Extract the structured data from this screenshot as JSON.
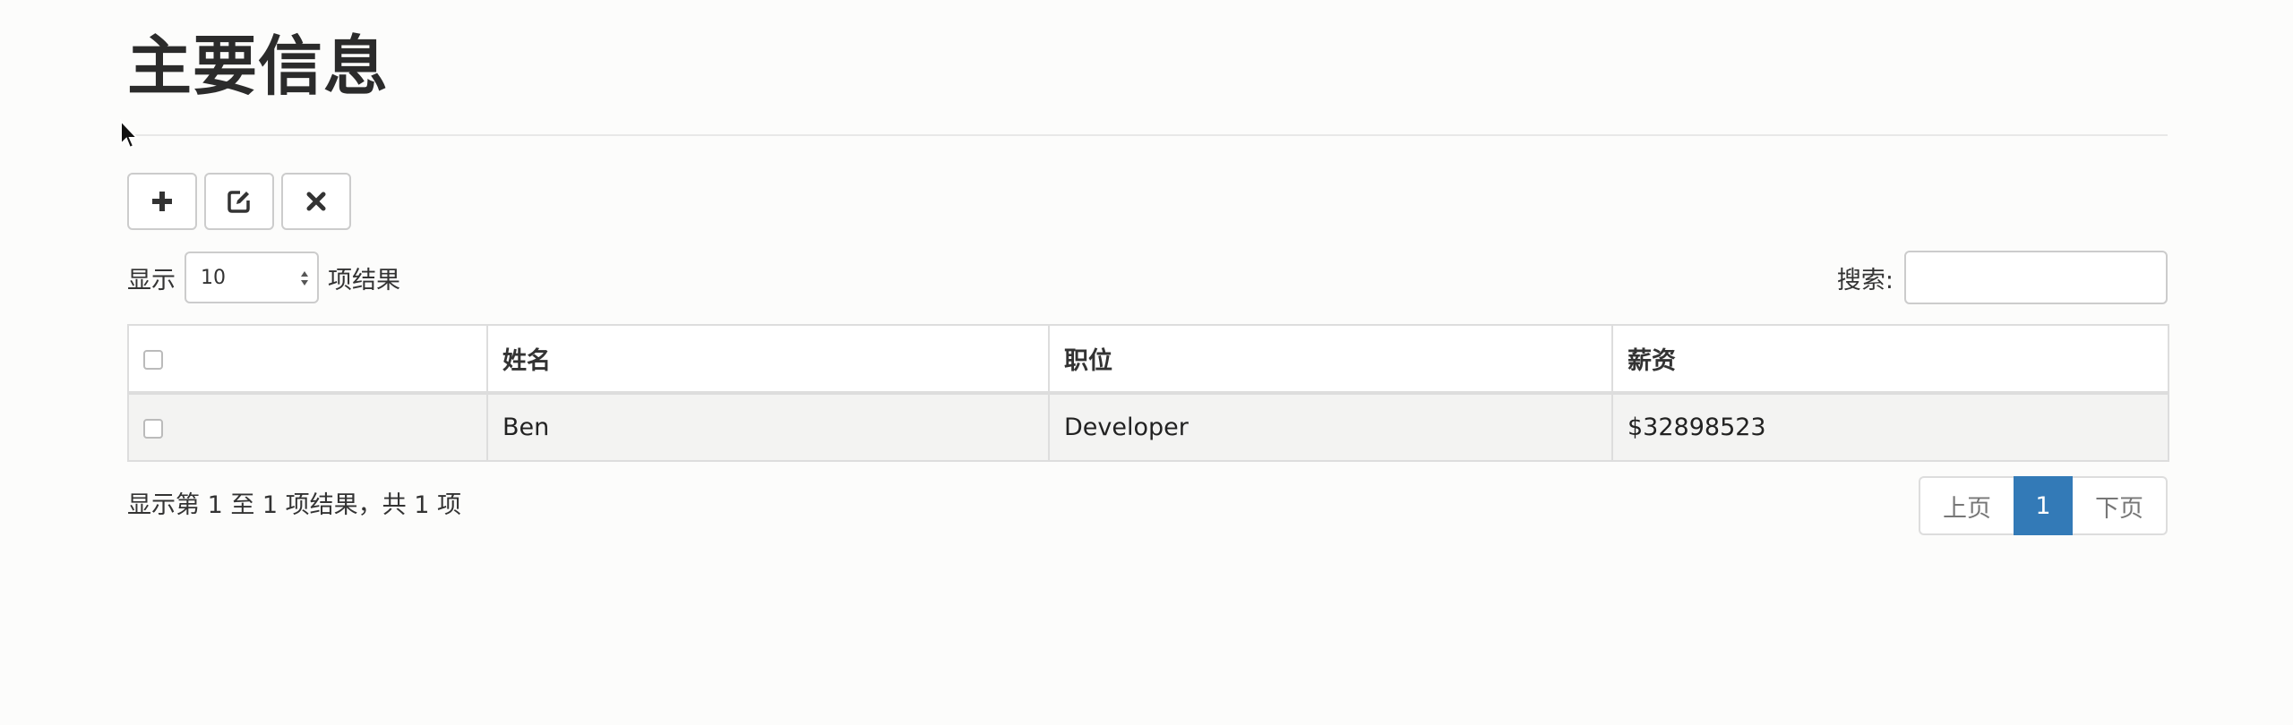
{
  "page": {
    "title": "主要信息"
  },
  "toolbar": {
    "add_icon": "plus-icon",
    "edit_icon": "edit-icon",
    "delete_icon": "x-icon"
  },
  "length_menu": {
    "prefix": "显示",
    "selected": "10",
    "suffix": "项结果"
  },
  "search": {
    "label": "搜索:",
    "value": "",
    "placeholder": ""
  },
  "table": {
    "columns": [
      "",
      "姓名",
      "职位",
      "薪资"
    ],
    "rows": [
      {
        "checked": false,
        "name": "Ben",
        "position": "Developer",
        "salary": "$32898523"
      }
    ]
  },
  "footer": {
    "info": "显示第 1 至 1 项结果，共 1 项",
    "prev_label": "上页",
    "current_page": "1",
    "next_label": "下页"
  },
  "colors": {
    "accent": "#337ab7",
    "background": "#fcfcfb",
    "row_bg": "#f3f3f2",
    "border": "#dddddd"
  }
}
